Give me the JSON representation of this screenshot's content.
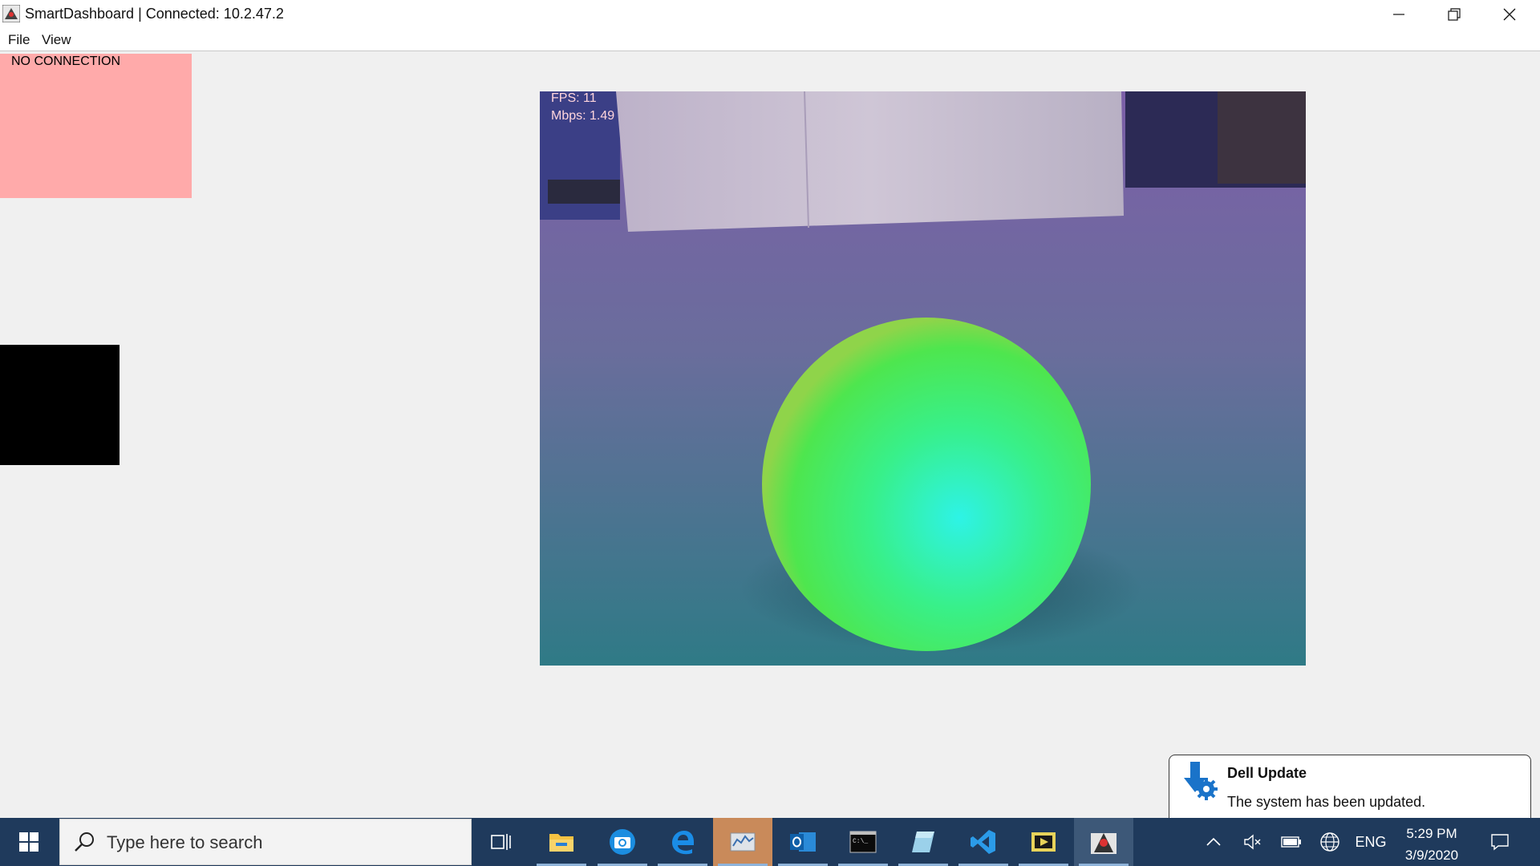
{
  "window": {
    "title": "SmartDashboard | Connected: 10.2.47.2"
  },
  "menu": {
    "items": [
      {
        "label": "File"
      },
      {
        "label": "View"
      }
    ]
  },
  "widgets": {
    "connection_status": "NO CONNECTION",
    "camera": {
      "fps_label": "FPS: 11",
      "mbps_label": "Mbps: 1.49"
    }
  },
  "notification": {
    "title": "Dell Update",
    "body": "The system has been updated."
  },
  "taskbar": {
    "search_placeholder": "Type here to search",
    "apps": [
      {
        "icon": "task-view-icon"
      },
      {
        "icon": "file-explorer-icon"
      },
      {
        "icon": "camera-app-icon"
      },
      {
        "icon": "edge-icon"
      },
      {
        "icon": "driver-station-icon"
      },
      {
        "icon": "outlook-icon"
      },
      {
        "icon": "terminal-icon"
      },
      {
        "icon": "notes-icon"
      },
      {
        "icon": "vscode-icon"
      },
      {
        "icon": "media-app-icon"
      },
      {
        "icon": "smartdashboard-icon"
      }
    ],
    "tray": {
      "language": "ENG",
      "time": "5:29 PM",
      "date": "3/9/2020"
    }
  },
  "colors": {
    "no_connection_bg": "#ffaaaa",
    "taskbar_bg": "#1f3a5c",
    "ball": "#3df070"
  }
}
